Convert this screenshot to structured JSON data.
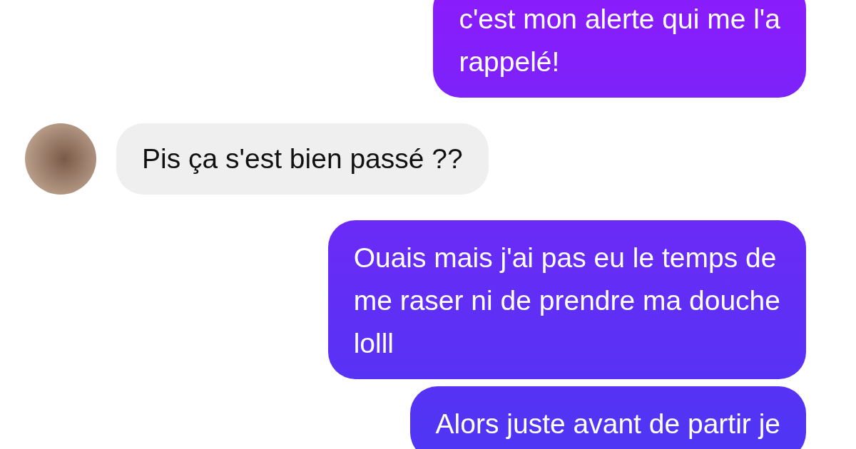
{
  "messages": [
    {
      "kind": "sent",
      "lines": [
        "c'est mon alerte qui me l'a",
        "rappelé!"
      ]
    },
    {
      "kind": "received",
      "lines": [
        "Pis ça s'est bien passé ??"
      ]
    },
    {
      "kind": "sent",
      "lines": [
        "Ouais mais j'ai pas eu le temps de",
        "me raser ni de prendre ma douche",
        "lolll"
      ]
    },
    {
      "kind": "sent",
      "lines": [
        "Alors juste avant de partir je"
      ]
    }
  ]
}
